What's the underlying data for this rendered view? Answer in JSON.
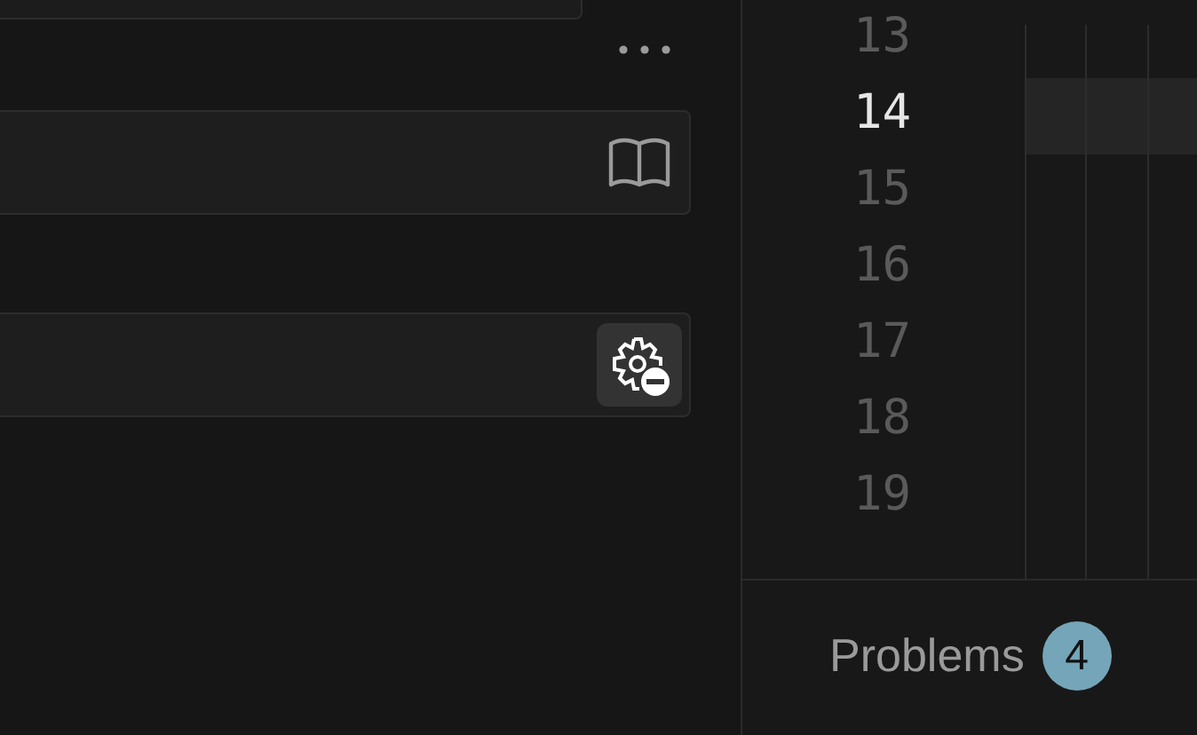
{
  "sidebar": {
    "cards": [
      {
        "kind": "book"
      },
      {
        "kind": "gear"
      }
    ]
  },
  "editor": {
    "line_numbers": [
      {
        "text": "13",
        "current": false
      },
      {
        "text": "14",
        "current": true
      },
      {
        "text": "15",
        "current": false
      },
      {
        "text": "16",
        "current": false
      },
      {
        "text": "17",
        "current": false
      },
      {
        "text": "18",
        "current": false
      },
      {
        "text": "19",
        "current": false
      }
    ]
  },
  "panel": {
    "tabs": [
      {
        "label": "Problems",
        "badge": "4"
      }
    ]
  }
}
